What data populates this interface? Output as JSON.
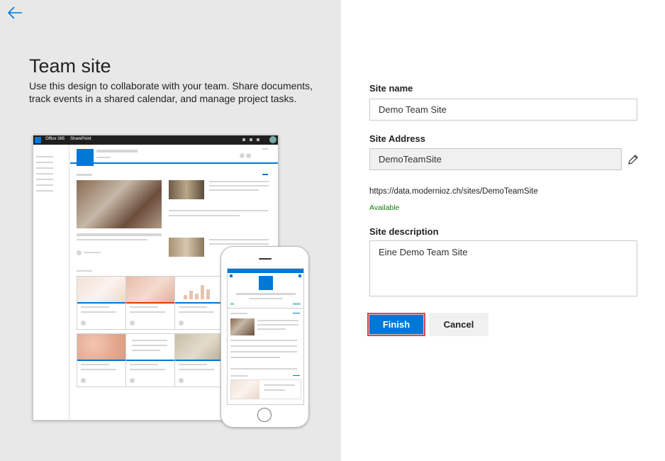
{
  "nav": {
    "back_icon": "arrow-left-icon"
  },
  "design": {
    "title": "Team site",
    "description": "Use this design to collaborate with your team. Share documents, track events in a shared calendar, and manage project tasks.",
    "preview": {
      "suite_bar_app": "Office 365",
      "suite_bar_product": "SharePoint"
    }
  },
  "form": {
    "site_name_label": "Site name",
    "site_name_value": "Demo Team Site",
    "site_address_label": "Site Address",
    "site_address_value": "DemoTeamSite",
    "site_url": "https://data.modernioz.ch/sites/DemoTeamSite",
    "availability": "Available",
    "site_description_label": "Site description",
    "site_description_value": "Eine Demo Team Site",
    "edit_icon": "pencil-icon",
    "finish_label": "Finish",
    "cancel_label": "Cancel"
  },
  "colors": {
    "accent": "#0078d4",
    "available": "#107c10",
    "left_panel_bg": "#e8e8e8",
    "highlight_border": "#e0454f"
  }
}
